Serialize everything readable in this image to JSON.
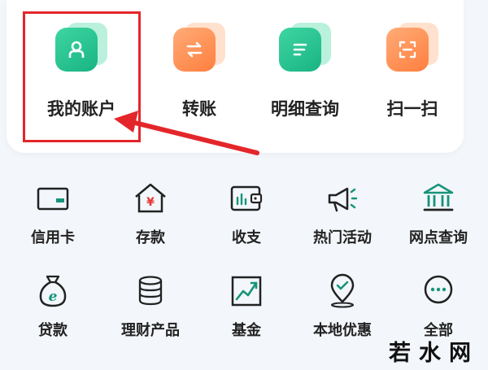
{
  "top_actions": [
    {
      "label": "我的账户",
      "icon": "user-icon"
    },
    {
      "label": "转账",
      "icon": "transfer-icon"
    },
    {
      "label": "明细查询",
      "icon": "list-icon"
    },
    {
      "label": "扫一扫",
      "icon": "scan-icon"
    }
  ],
  "services": [
    {
      "label": "信用卡",
      "icon": "credit-card-icon"
    },
    {
      "label": "存款",
      "icon": "deposit-icon"
    },
    {
      "label": "收支",
      "icon": "wallet-icon"
    },
    {
      "label": "热门活动",
      "icon": "megaphone-icon"
    },
    {
      "label": "网点查询",
      "icon": "bank-branch-icon"
    },
    {
      "label": "贷款",
      "icon": "loan-bag-icon"
    },
    {
      "label": "理财产品",
      "icon": "coins-icon"
    },
    {
      "label": "基金",
      "icon": "fund-chart-icon"
    },
    {
      "label": "本地优惠",
      "icon": "location-icon"
    },
    {
      "label": "全部",
      "icon": "more-icon"
    }
  ],
  "watermark": {
    "text": "若水网"
  },
  "colors": {
    "accent_green": "#19b383",
    "accent_orange": "#ff7f3f",
    "highlight_red": "#e4262a",
    "icon_green": "#16947a"
  }
}
